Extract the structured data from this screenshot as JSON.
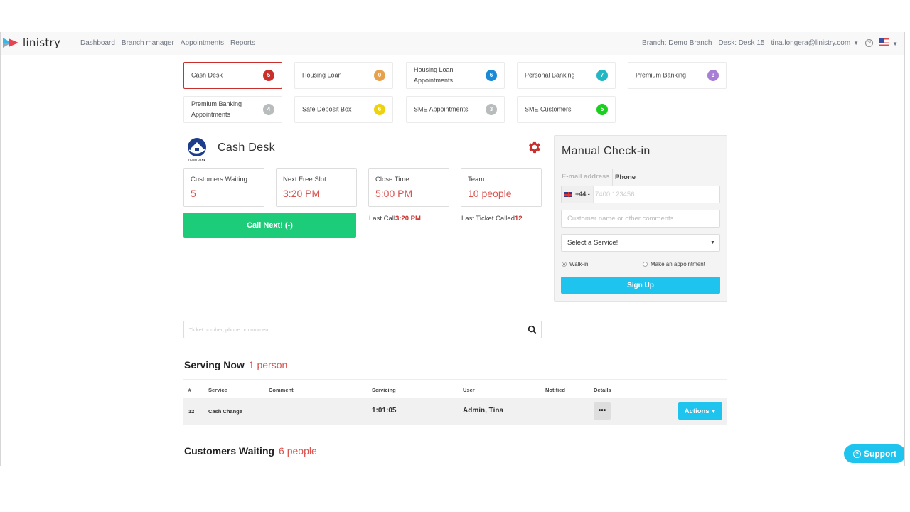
{
  "app": {
    "logo_text": "linistry",
    "nav": [
      "Dashboard",
      "Branch manager",
      "Appointments",
      "Reports"
    ],
    "branch": "Branch: Demo Branch",
    "desk": "Desk: Desk 15",
    "user_email": "tina.longera@linistry.com",
    "help_glyph": "?",
    "language_flag": "us-flag-icon"
  },
  "services": [
    {
      "label": "Cash Desk",
      "count": "5",
      "color": "#c9302c",
      "active": true
    },
    {
      "label": "Housing Loan",
      "count": "0",
      "color": "#e8a04b",
      "active": false
    },
    {
      "label": "Housing Loan Appointments",
      "count": "6",
      "color": "#1b8ad6",
      "active": false
    },
    {
      "label": "Personal Banking",
      "count": "7",
      "color": "#23b7c4",
      "active": false
    },
    {
      "label": "Premium Banking",
      "count": "3",
      "color": "#a87dd6",
      "active": false
    },
    {
      "label": "Premium Banking Appointments",
      "count": "4",
      "color": "#b8bcbc",
      "active": false
    },
    {
      "label": "Safe Deposit Box",
      "count": "6",
      "color": "#eed30c",
      "active": false
    },
    {
      "label": "SME Appointments",
      "count": "3",
      "color": "#b8bcbc",
      "active": false
    },
    {
      "label": "SME Customers",
      "count": "5",
      "color": "#17d11d",
      "active": false
    }
  ],
  "queue": {
    "logo_caption": "DEMO BANK",
    "title": "Cash Desk",
    "stats": [
      {
        "label": "Customers Waiting",
        "value": "5"
      },
      {
        "label": "Next Free Slot",
        "value": "3:20 PM"
      },
      {
        "label": "Close Time",
        "value": "5:00 PM"
      },
      {
        "label": "Team",
        "value": "10 people"
      }
    ],
    "call_next_label": "Call Next! (-)",
    "last_call_label": "Last Call",
    "last_call_value": "3:20 PM",
    "last_ticket_label": "Last Ticket Called",
    "last_ticket_value": "12"
  },
  "checkin": {
    "title": "Manual Check-in",
    "tab_email": "E-mail address",
    "tab_phone": "Phone",
    "phone_prefix": "+44 -",
    "phone_placeholder": "7400 123456",
    "comment_placeholder": "Customer name or other comments...",
    "service_select": "Select a Service!",
    "radio_walkin": "Walk-in",
    "radio_appointment": "Make an appointment",
    "walkin_selected": true,
    "signup_label": "Sign Up"
  },
  "search": {
    "placeholder": "Ticket number, phone or comment..."
  },
  "serving_now": {
    "title": "Serving Now",
    "count": "1 person",
    "columns": [
      "#",
      "Service",
      "Comment",
      "Servicing",
      "User",
      "Notified",
      "Details"
    ],
    "rows": [
      {
        "number": "12",
        "service": "Cash Change",
        "comment": "",
        "servicing": "1:01:05",
        "user": "Admin, Tina",
        "notified": "",
        "details_label": "•••",
        "actions_label": "Actions"
      }
    ]
  },
  "customers_waiting": {
    "title": "Customers Waiting",
    "count": "6 people"
  },
  "support": {
    "label": "Support"
  }
}
